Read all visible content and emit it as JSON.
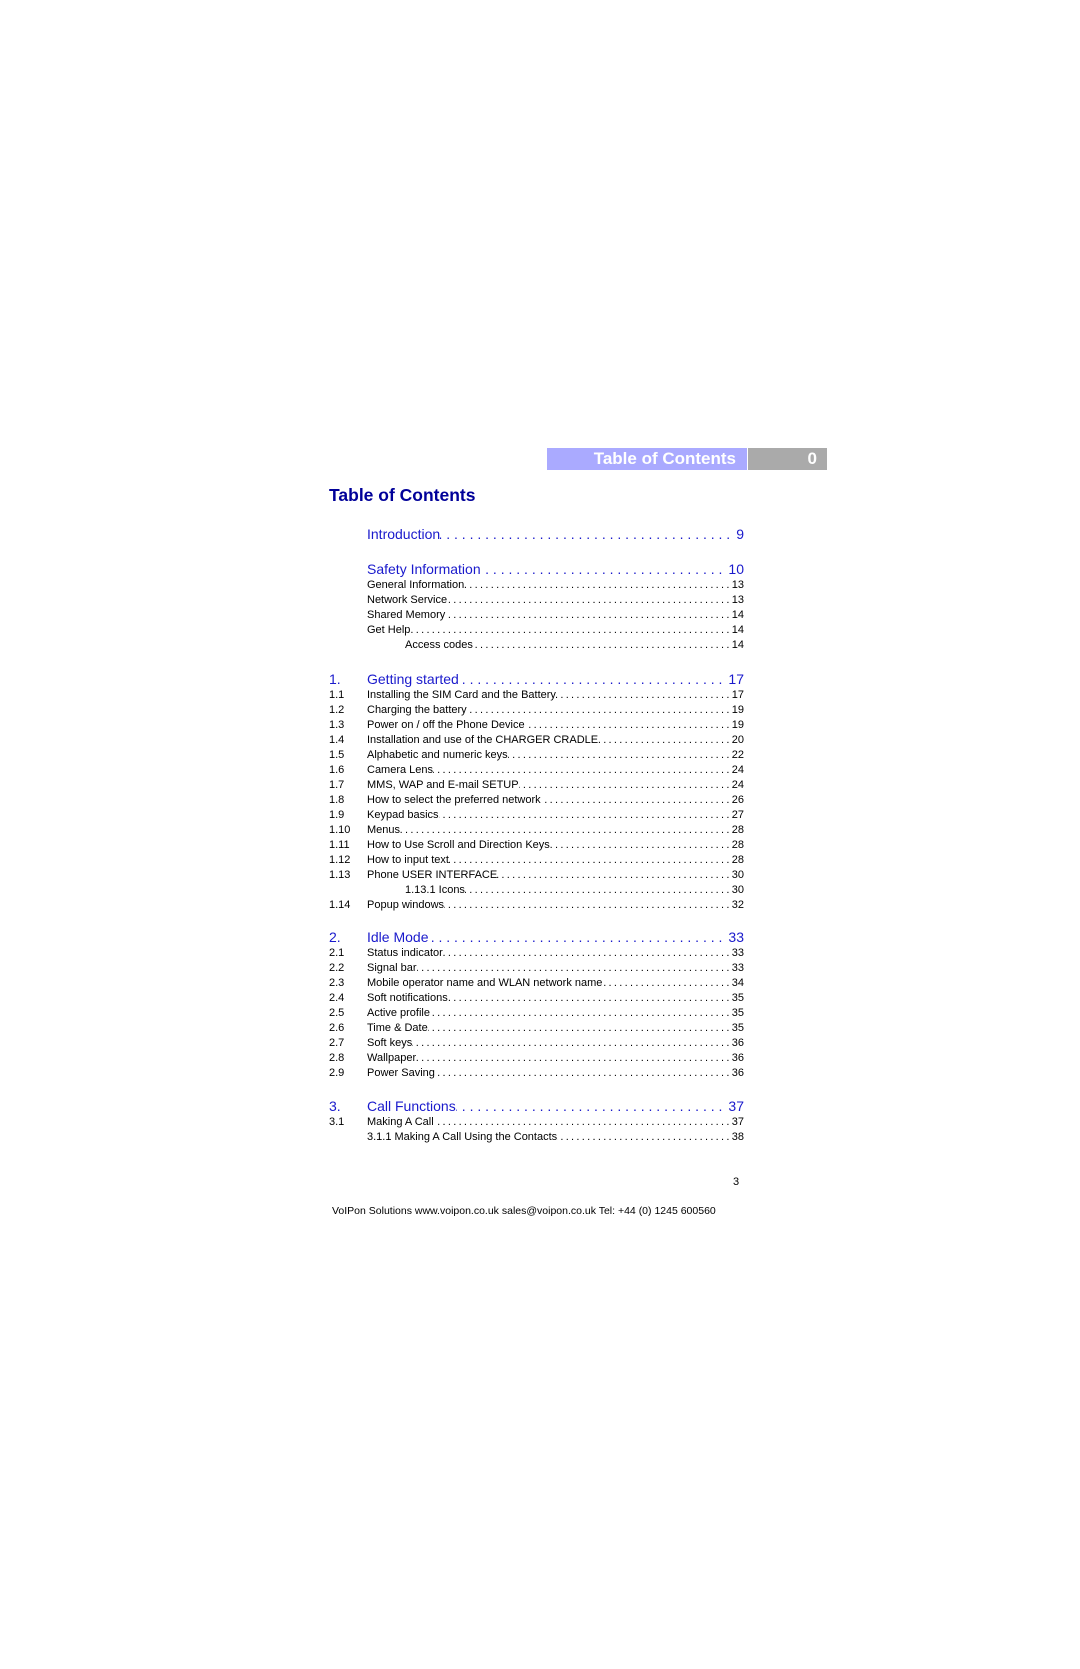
{
  "header": {
    "section_title": "Table of Contents",
    "section_number": "0"
  },
  "heading": "Table of Contents",
  "entries": [
    {
      "level": "main",
      "num": "",
      "title": "Introduction",
      "page": "9"
    },
    {
      "level": "main",
      "num": "",
      "title": "Safety Information",
      "page": "10"
    },
    {
      "level": "sub",
      "num": "",
      "title": "General Information",
      "page": "13"
    },
    {
      "level": "sub",
      "num": "",
      "title": "Network Service",
      "page": "13"
    },
    {
      "level": "sub",
      "num": "",
      "title": "Shared Memory",
      "page": "14"
    },
    {
      "level": "sub",
      "num": "",
      "title": "Get Help",
      "page": "14"
    },
    {
      "level": "subsub",
      "num": "",
      "title": "Access codes",
      "page": "14"
    },
    {
      "level": "main",
      "num": "1.",
      "title": "Getting started",
      "page": "17"
    },
    {
      "level": "sub",
      "num": "1.1",
      "title": "Installing the SIM Card and the Battery",
      "page": "17"
    },
    {
      "level": "sub",
      "num": "1.2",
      "title": "Charging the battery",
      "page": "19"
    },
    {
      "level": "sub",
      "num": "1.3",
      "title": "Power on / off the Phone Device",
      "page": "19"
    },
    {
      "level": "sub",
      "num": "1.4",
      "title": "Installation and use of the CHARGER CRADLE",
      "page": "20"
    },
    {
      "level": "sub",
      "num": "1.5",
      "title": "Alphabetic and numeric keys",
      "page": "22"
    },
    {
      "level": "sub",
      "num": "1.6",
      "title": "Camera Lens",
      "page": "24"
    },
    {
      "level": "sub",
      "num": "1.7",
      "title": "MMS, WAP and E-mail SETUP",
      "page": "24"
    },
    {
      "level": "sub",
      "num": "1.8",
      "title": "How to select the preferred network",
      "page": "26"
    },
    {
      "level": "sub",
      "num": "1.9",
      "title": "Keypad basics",
      "page": "27"
    },
    {
      "level": "sub",
      "num": "1.10",
      "title": "Menus",
      "page": "28"
    },
    {
      "level": "sub",
      "num": "1.11",
      "title": "How to Use Scroll and Direction Keys",
      "page": "28"
    },
    {
      "level": "sub",
      "num": "1.12",
      "title": "How to input text",
      "page": "28"
    },
    {
      "level": "sub",
      "num": "1.13",
      "title": "Phone USER INTERFACE",
      "page": "30"
    },
    {
      "level": "subsub",
      "num": "",
      "title": "1.13.1 Icons",
      "page": "30"
    },
    {
      "level": "sub",
      "num": "1.14",
      "title": "Popup windows",
      "page": "32"
    },
    {
      "level": "main",
      "num": "2.",
      "title": "Idle Mode",
      "page": "33"
    },
    {
      "level": "sub",
      "num": "2.1",
      "title": "Status indicator",
      "page": "33"
    },
    {
      "level": "sub",
      "num": "2.2",
      "title": "Signal bar",
      "page": "33"
    },
    {
      "level": "sub",
      "num": "2.3",
      "title": "Mobile operator name and WLAN network name",
      "page": "34"
    },
    {
      "level": "sub",
      "num": "2.4",
      "title": "Soft notifications",
      "page": "35"
    },
    {
      "level": "sub",
      "num": "2.5",
      "title": "Active profile",
      "page": "35"
    },
    {
      "level": "sub",
      "num": "2.6",
      "title": "Time & Date",
      "page": "35"
    },
    {
      "level": "sub",
      "num": "2.7",
      "title": "Soft keys",
      "page": "36"
    },
    {
      "level": "sub",
      "num": "2.8",
      "title": "Wallpaper",
      "page": "36"
    },
    {
      "level": "sub",
      "num": "2.9",
      "title": "Power Saving",
      "page": "36"
    },
    {
      "level": "main",
      "num": "3.",
      "title": "Call Functions",
      "page": "37"
    },
    {
      "level": "sub",
      "num": "3.1",
      "title": "Making A Call",
      "page": "37"
    },
    {
      "level": "sub",
      "num": "",
      "title": "3.1.1   Making A Call Using the Contacts",
      "page": "38"
    }
  ],
  "page_number": "3",
  "footer": "VoIPon Solutions  www.voipon.co.uk  sales@voipon.co.uk  Tel: +44 (0) 1245 600560",
  "colors": {
    "heading": "#000099",
    "main_entry": "#1a1acc",
    "header_blue": "#aaaaff",
    "header_gray": "#aaaaaa"
  }
}
